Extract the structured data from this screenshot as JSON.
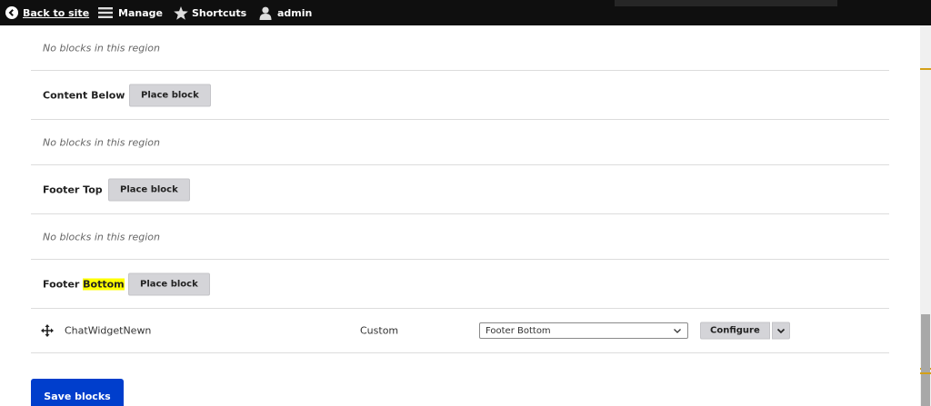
{
  "toolbar": {
    "back_label": "Back to site",
    "manage_label": "Manage",
    "shortcuts_label": "Shortcuts",
    "user_label": "admin"
  },
  "regions": [
    {
      "kind": "empty",
      "message": "No blocks in this region"
    },
    {
      "kind": "region",
      "title": "Content Below",
      "button": "Place block"
    },
    {
      "kind": "empty",
      "message": "No blocks in this region"
    },
    {
      "kind": "region",
      "title": "Footer Top",
      "button": "Place block"
    },
    {
      "kind": "empty",
      "message": "No blocks in this region"
    },
    {
      "kind": "region",
      "title_plain": "Footer ",
      "title_highlight": "Bottom",
      "button": "Place block"
    }
  ],
  "block": {
    "name": "ChatWidgetNewn",
    "category": "Custom",
    "region_value": "Footer Bottom",
    "configure_label": "Configure"
  },
  "actions": {
    "save_label": "Save blocks"
  },
  "colors": {
    "toolbar_bg": "#0f0f0f",
    "primary_button": "#003ecc",
    "highlight": "#ffff00"
  }
}
